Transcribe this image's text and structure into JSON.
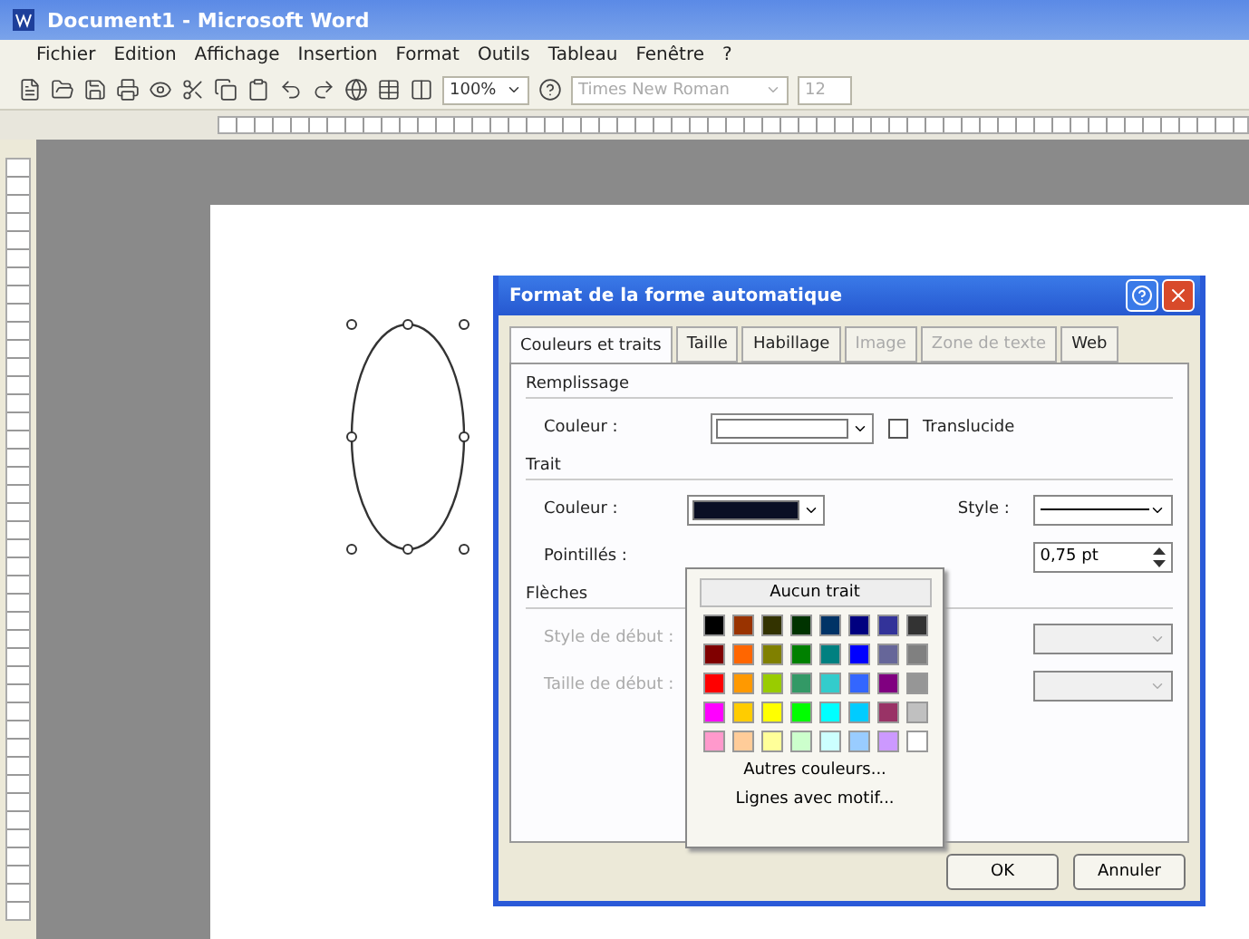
{
  "window": {
    "title": "Document1 - Microsoft Word"
  },
  "menu": [
    "Fichier",
    "Edition",
    "Affichage",
    "Insertion",
    "Format",
    "Outils",
    "Tableau",
    "Fenêtre",
    "?"
  ],
  "toolbar": {
    "zoom": "100%",
    "font": "Times New Roman",
    "size": "12"
  },
  "dialog": {
    "title": "Format de la forme automatique",
    "tabs": [
      {
        "label": "Couleurs et traits",
        "selected": true,
        "disabled": false
      },
      {
        "label": "Taille",
        "selected": false,
        "disabled": false
      },
      {
        "label": "Habillage",
        "selected": false,
        "disabled": false
      },
      {
        "label": "Image",
        "selected": false,
        "disabled": true
      },
      {
        "label": "Zone de texte",
        "selected": false,
        "disabled": true
      },
      {
        "label": "Web",
        "selected": false,
        "disabled": false
      }
    ],
    "fill": {
      "heading": "Remplissage",
      "color_label": "Couleur :",
      "color": "#ffffff",
      "translucent_label": "Translucide",
      "translucent": false
    },
    "line": {
      "heading": "Trait",
      "color_label": "Couleur :",
      "color": "#0a0f24",
      "style_label": "Style :",
      "dash_label": "Pointillés :",
      "weight": "0,75 pt"
    },
    "arrows": {
      "heading": "Flèches",
      "begin_style_label": "Style de début :",
      "begin_size_label": "Taille de début :",
      "disabled": true
    },
    "palette": {
      "none_button": "Aucun trait",
      "colors": [
        {
          "color": "#000000"
        },
        {
          "color": "#993300"
        },
        {
          "color": "#333300"
        },
        {
          "color": "#003300"
        },
        {
          "color": "#003366"
        },
        {
          "color": "#000080"
        },
        {
          "color": "#333399"
        },
        {
          "color": "#333333"
        },
        {
          "color": "#800000"
        },
        {
          "color": "#ff6600"
        },
        {
          "color": "#808000"
        },
        {
          "color": "#008000"
        },
        {
          "color": "#008080"
        },
        {
          "color": "#0000ff"
        },
        {
          "color": "#666699"
        },
        {
          "color": "#808080"
        },
        {
          "color": "#ff0000"
        },
        {
          "color": "#ff9900"
        },
        {
          "color": "#99cc00"
        },
        {
          "color": "#339966"
        },
        {
          "color": "#33cccc"
        },
        {
          "color": "#3366ff"
        },
        {
          "color": "#800080"
        },
        {
          "color": "#969696"
        },
        {
          "color": "#ff00ff"
        },
        {
          "color": "#ffcc00"
        },
        {
          "color": "#ffff00"
        },
        {
          "color": "#00ff00"
        },
        {
          "color": "#00ffff"
        },
        {
          "color": "#00ccff"
        },
        {
          "color": "#993366"
        },
        {
          "color": "#c0c0c0"
        },
        {
          "color": "#ff99cc"
        },
        {
          "color": "#ffcc99"
        },
        {
          "color": "#ffff99"
        },
        {
          "color": "#ccffcc"
        },
        {
          "color": "#ccffff"
        },
        {
          "color": "#99ccff"
        },
        {
          "color": "#cc99ff"
        },
        {
          "color": "#ffffff"
        }
      ],
      "more": "Autres couleurs...",
      "patterns": "Lignes avec motif..."
    },
    "buttons": [
      "OK",
      "Annuler"
    ]
  }
}
